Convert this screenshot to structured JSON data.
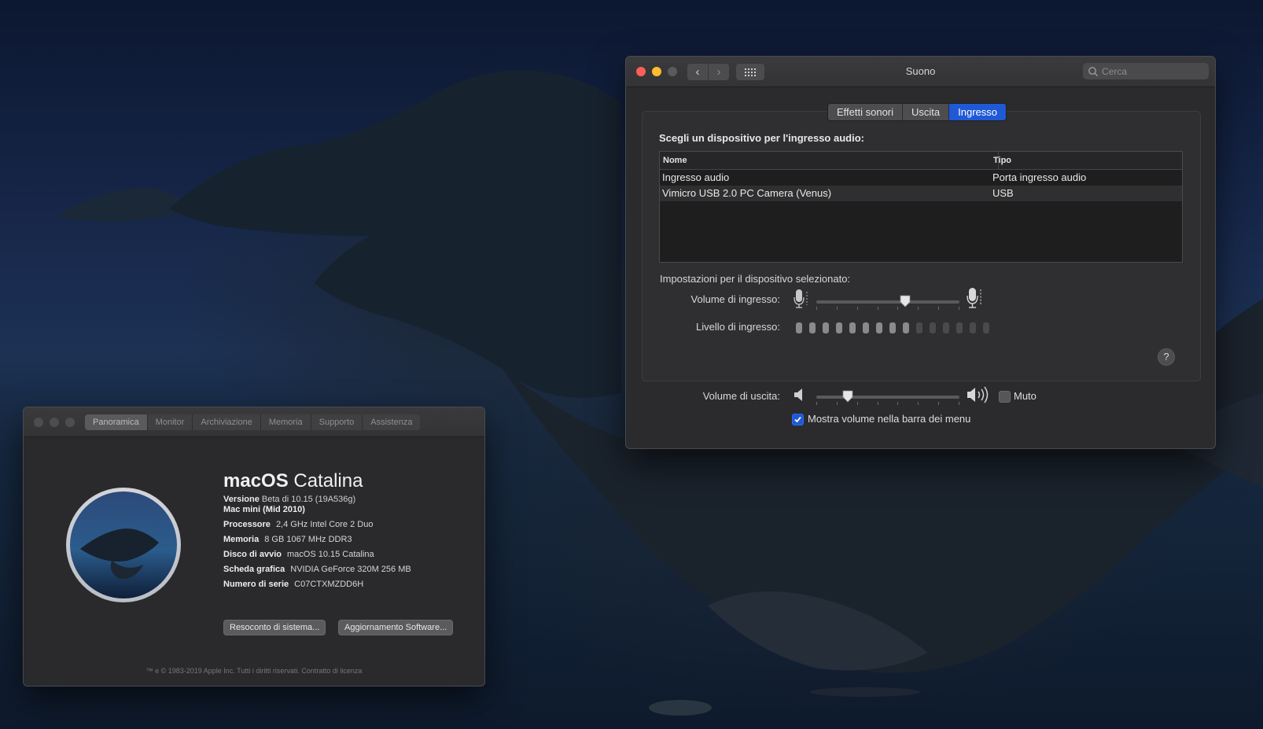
{
  "sound": {
    "title": "Suono",
    "search_placeholder": "Cerca",
    "tabs": [
      {
        "label": "Effetti sonori",
        "active": false
      },
      {
        "label": "Uscita",
        "active": false
      },
      {
        "label": "Ingresso",
        "active": true
      }
    ],
    "heading": "Scegli un dispositivo per l'ingresso audio:",
    "table": {
      "columns": [
        "Nome",
        "Tipo"
      ],
      "rows": [
        {
          "name": "Ingresso audio",
          "type": "Porta ingresso audio",
          "selected": false
        },
        {
          "name": "Vimicro USB 2.0 PC Camera (Venus)",
          "type": "USB",
          "selected": true
        }
      ]
    },
    "settings_heading": "Impostazioni per il dispositivo selezionato:",
    "input_volume_label": "Volume di ingresso:",
    "input_volume_value": 0.62,
    "input_level_label": "Livello di ingresso:",
    "input_level_bars": 15,
    "input_level_active": 9,
    "help_label": "?",
    "output_volume_label": "Volume di uscita:",
    "output_volume_value": 0.22,
    "mute_label": "Muto",
    "mute_checked": false,
    "show_volume_label": "Mostra volume nella barra dei menu",
    "show_volume_checked": true
  },
  "about": {
    "tabs": [
      {
        "label": "Panoramica",
        "active": true
      },
      {
        "label": "Monitor",
        "active": false
      },
      {
        "label": "Archiviazione",
        "active": false
      },
      {
        "label": "Memoria",
        "active": false
      },
      {
        "label": "Supporto",
        "active": false
      },
      {
        "label": "Assistenza",
        "active": false
      }
    ],
    "os_name_bold": "macOS",
    "os_name_rest": "Catalina",
    "version_label": "Versione",
    "version_value": "Beta di 10.15 (19A536g)",
    "model": "Mac mini (Mid 2010)",
    "specs": [
      {
        "label": "Processore",
        "value": "2,4 GHz Intel Core 2 Duo"
      },
      {
        "label": "Memoria",
        "value": "8 GB 1067 MHz DDR3"
      },
      {
        "label": "Disco di avvio",
        "value": "macOS 10.15 Catalina"
      },
      {
        "label": "Scheda grafica",
        "value": "NVIDIA GeForce 320M 256 MB"
      },
      {
        "label": "Numero di serie",
        "value": "C07CTXMZDD6H"
      }
    ],
    "buttons": {
      "system_report": "Resoconto di sistema...",
      "software_update": "Aggiornamento Software..."
    },
    "footer": "™ e © 1983-2019 Apple Inc. Tutti i diritti riservati. Contratto di licenza"
  },
  "colors": {
    "close": "#fe5f57",
    "minimize": "#febc2e",
    "maximize": "#5a5a5d",
    "inactive_dot": "#4d4d50",
    "accent": "#1f59d6",
    "level_on": "#8a8a8d",
    "level_off": "#4a4a4d"
  }
}
